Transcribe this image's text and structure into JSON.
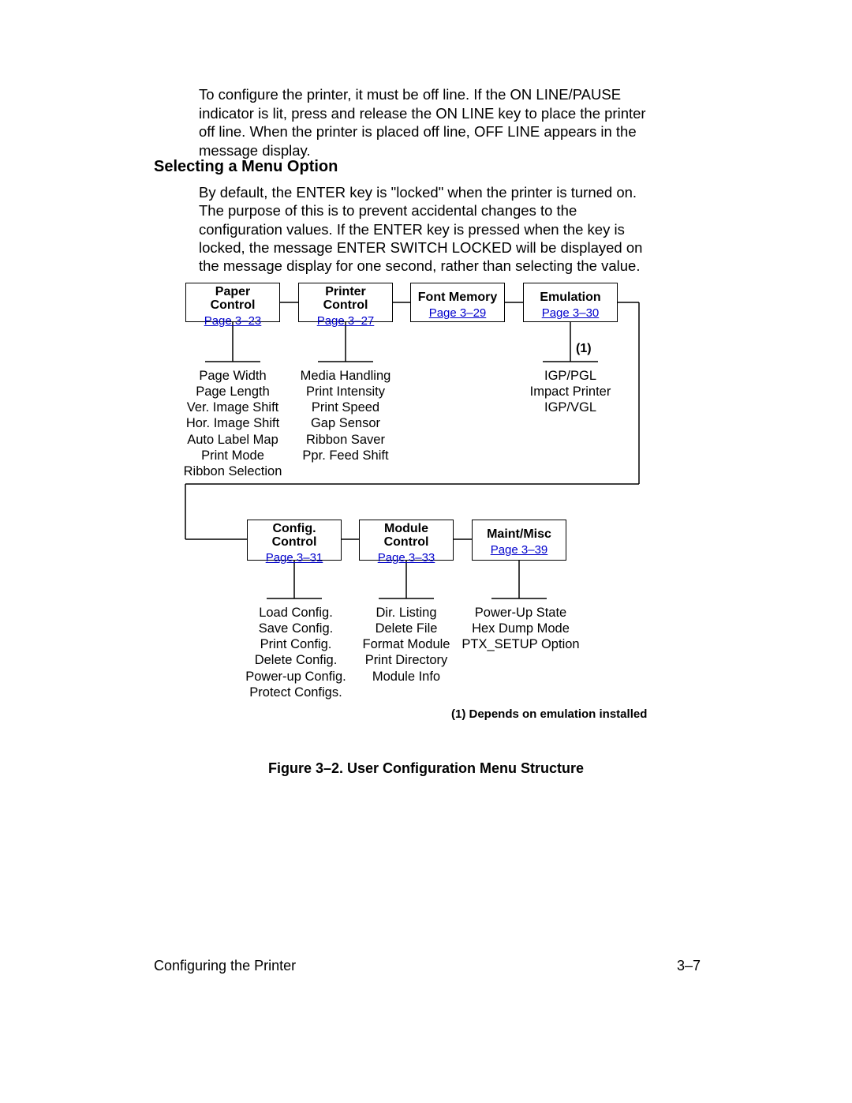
{
  "intro_paragraph": "To configure the printer, it must be off line. If the ON LINE/PAUSE indicator is lit, press and release the ON LINE key to place the printer off line. When the printer is placed off line, OFF LINE appears in the message display.",
  "heading": "Selecting a Menu Option",
  "body_paragraph": "By default, the ENTER key is \"locked\" when the printer is turned on. The purpose of this is to prevent accidental changes to the configuration values. If the ENTER key is pressed when the key is locked, the message ENTER SWITCH LOCKED will be displayed on the message display for one second, rather than selecting the value.",
  "boxes": {
    "paper": {
      "title": "Paper\nControl",
      "link": "Page 3–23"
    },
    "printer": {
      "title": "Printer\nControl",
      "link": "Page 3–27"
    },
    "font": {
      "title": "Font Memory",
      "link": "Page 3–29"
    },
    "emul": {
      "title": "Emulation",
      "link": "Page 3–30"
    },
    "config": {
      "title": "Config.\nControl",
      "link": "Page 3–31"
    },
    "module": {
      "title": "Module\nControl",
      "link": "Page 3–33"
    },
    "maint": {
      "title": "Maint/Misc",
      "link": "Page 3–39"
    }
  },
  "note_ref": "(1)",
  "subitems": {
    "paper": "Page Width\nPage Length\nVer. Image Shift\nHor. Image Shift\nAuto Label Map\nPrint Mode\nRibbon Selection",
    "printer": "Media Handling\nPrint Intensity\nPrint Speed\nGap Sensor\nRibbon Saver\nPpr. Feed Shift",
    "emul": "IGP/PGL\nImpact Printer\nIGP/VGL",
    "config": "Load Config.\nSave Config.\nPrint Config.\nDelete Config.\nPower-up Config.\nProtect Configs.",
    "module": "Dir. Listing\nDelete File\nFormat Module\nPrint Directory\nModule Info",
    "maint": "Power-Up State\nHex Dump Mode\nPTX_SETUP Option"
  },
  "footnote": "(1) Depends on emulation installed",
  "figure_caption": "Figure 3–2. User Configuration Menu Structure",
  "footer_left": "Configuring the Printer",
  "footer_right": "3–7"
}
